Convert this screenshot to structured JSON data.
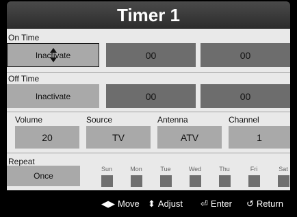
{
  "title": "Timer 1",
  "on_time": {
    "label": "On Time",
    "mode": "Inactivate",
    "hour": "00",
    "minute": "00"
  },
  "off_time": {
    "label": "Off Time",
    "mode": "Inactivate",
    "hour": "00",
    "minute": "00"
  },
  "volume": {
    "label": "Volume",
    "value": "20"
  },
  "source": {
    "label": "Source",
    "value": "TV"
  },
  "antenna": {
    "label": "Antenna",
    "value": "ATV"
  },
  "channel": {
    "label": "Channel",
    "value": "1"
  },
  "repeat": {
    "label": "Repeat",
    "value": "Once"
  },
  "days": [
    "Sun",
    "Mon",
    "Tue",
    "Wed",
    "Thu",
    "Fri",
    "Sat"
  ],
  "footer": {
    "move": "Move",
    "adjust": "Adjust",
    "enter": "Enter",
    "return": "Return"
  },
  "icons": {
    "move": "left-right-arrows-icon",
    "adjust": "up-down-arrows-icon",
    "enter": "enter-icon",
    "return": "return-icon"
  }
}
